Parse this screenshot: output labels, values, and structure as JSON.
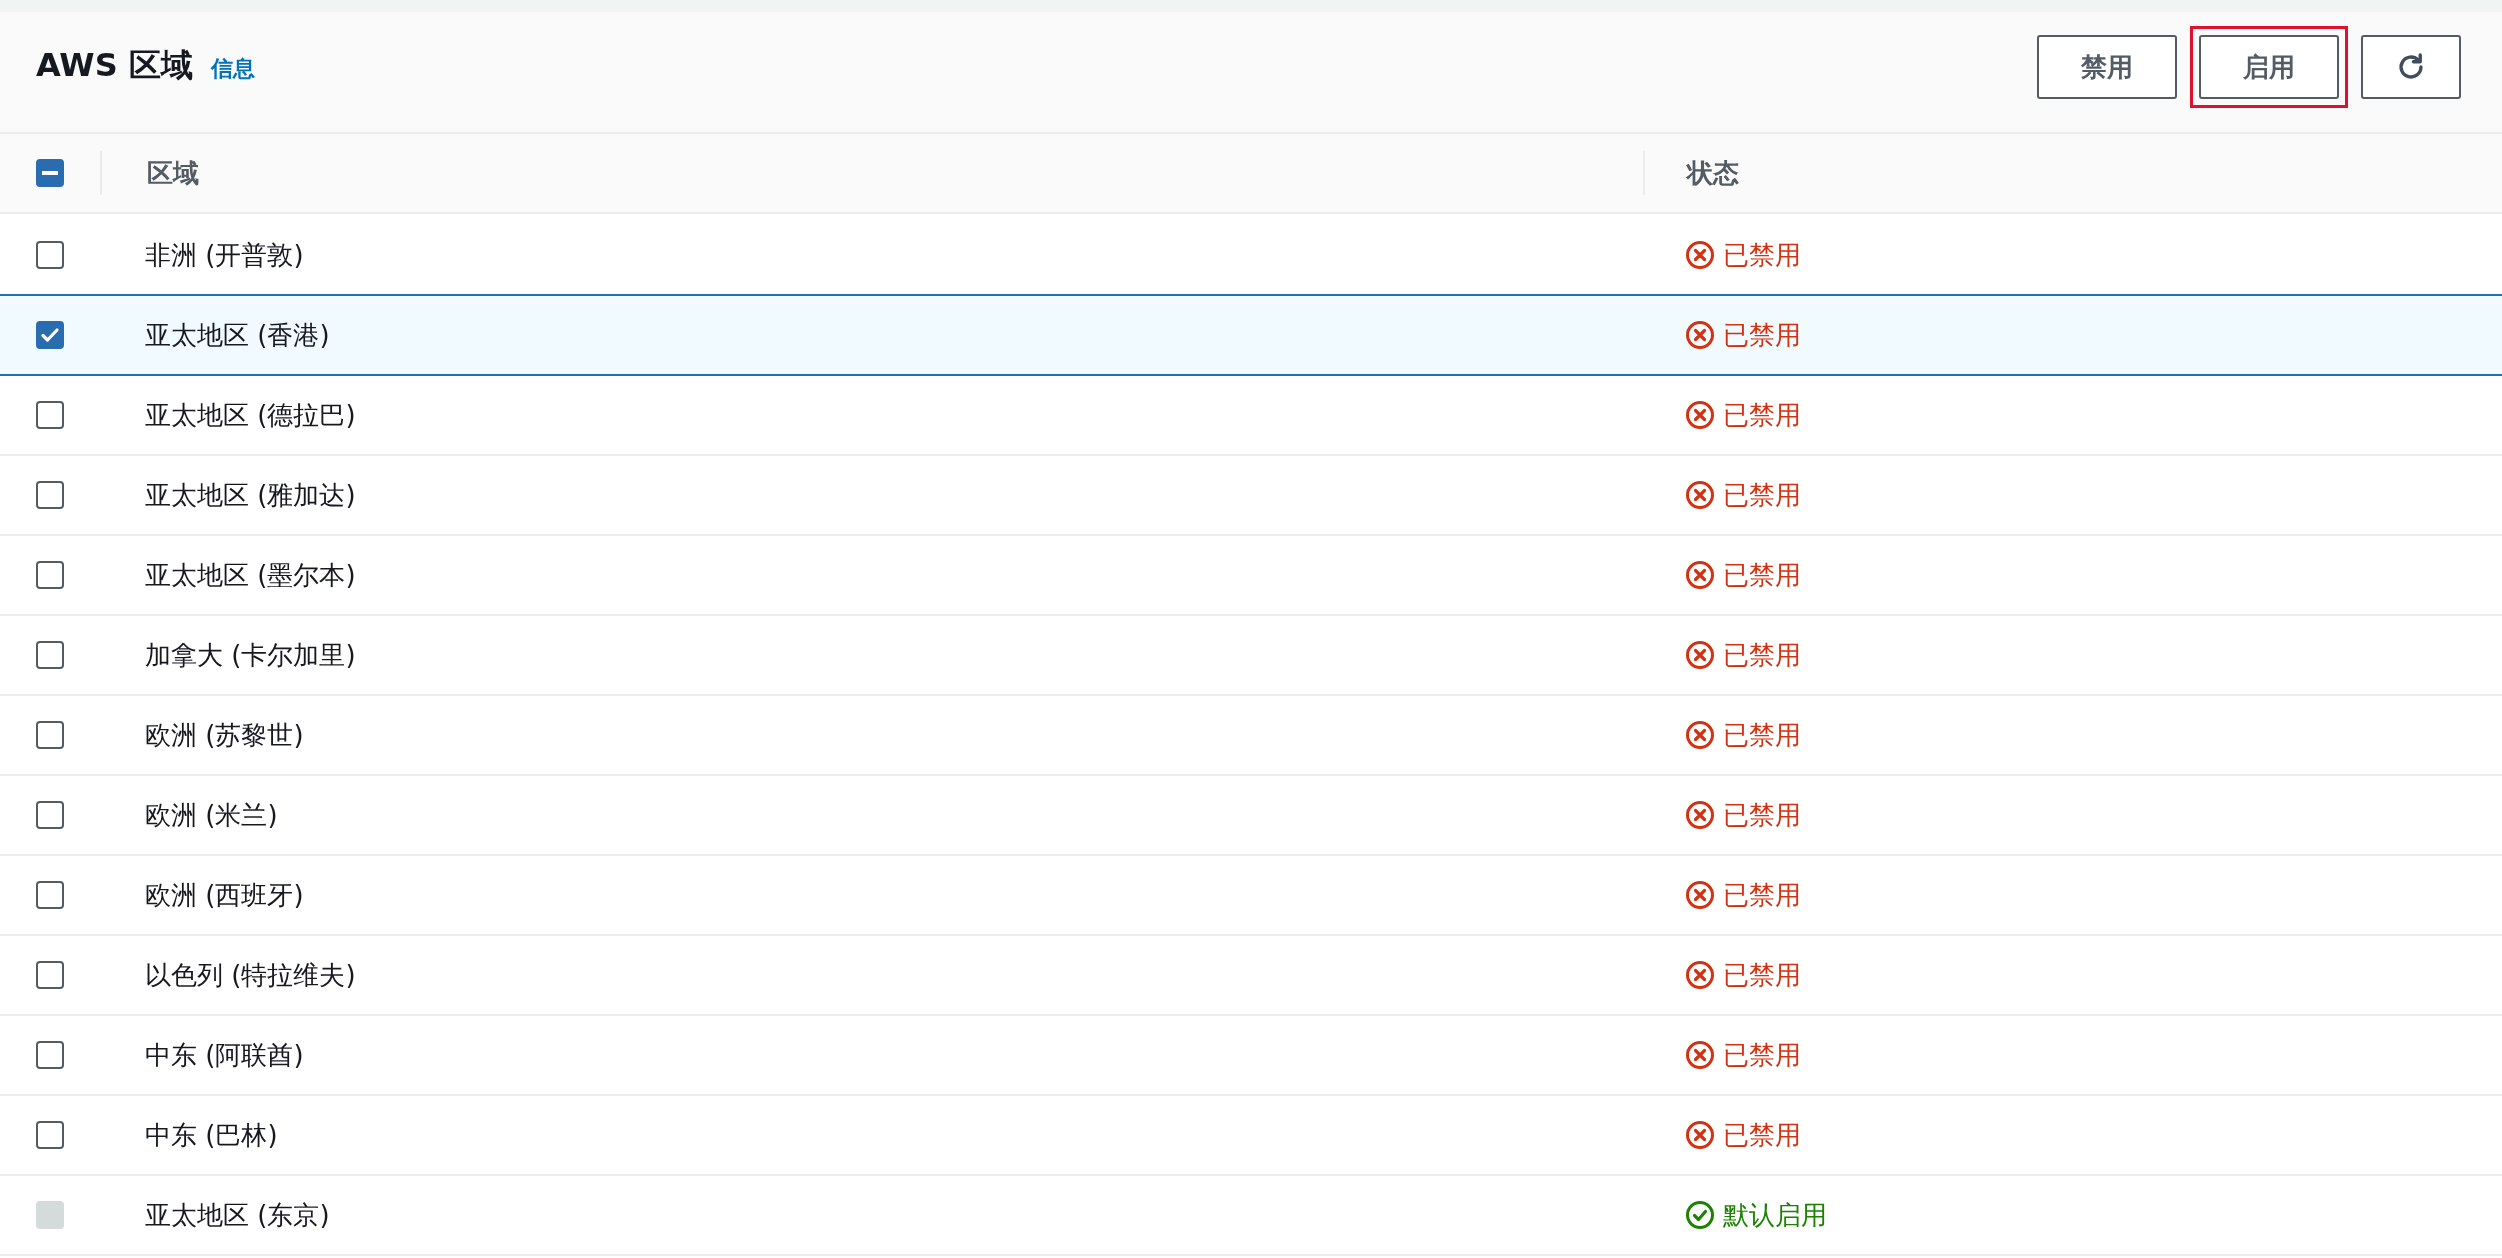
{
  "header": {
    "title": "AWS 区域",
    "info_link": "信息",
    "buttons": [
      {
        "kind": "text",
        "label": "禁用",
        "highlighted": false
      },
      {
        "kind": "text",
        "label": "启用",
        "highlighted": true
      },
      {
        "kind": "refresh",
        "highlighted": false
      }
    ]
  },
  "table": {
    "select_all": {
      "indeterminate": true
    },
    "columns": [
      "区域",
      "状态"
    ],
    "rows": [
      {
        "region": "非洲 (开普敦)",
        "status": "已禁用",
        "kind": "disabled",
        "selected": false,
        "locked": false
      },
      {
        "region": "亚太地区 (香港)",
        "status": "已禁用",
        "kind": "disabled",
        "selected": true,
        "locked": false
      },
      {
        "region": "亚太地区 (德拉巴)",
        "status": "已禁用",
        "kind": "disabled",
        "selected": false,
        "locked": false
      },
      {
        "region": "亚太地区 (雅加达)",
        "status": "已禁用",
        "kind": "disabled",
        "selected": false,
        "locked": false
      },
      {
        "region": "亚太地区 (墨尔本)",
        "status": "已禁用",
        "kind": "disabled",
        "selected": false,
        "locked": false
      },
      {
        "region": "加拿大 (卡尔加里)",
        "status": "已禁用",
        "kind": "disabled",
        "selected": false,
        "locked": false
      },
      {
        "region": "欧洲 (苏黎世)",
        "status": "已禁用",
        "kind": "disabled",
        "selected": false,
        "locked": false
      },
      {
        "region": "欧洲 (米兰)",
        "status": "已禁用",
        "kind": "disabled",
        "selected": false,
        "locked": false
      },
      {
        "region": "欧洲 (西班牙)",
        "status": "已禁用",
        "kind": "disabled",
        "selected": false,
        "locked": false
      },
      {
        "region": "以色列 (特拉维夫)",
        "status": "已禁用",
        "kind": "disabled",
        "selected": false,
        "locked": false
      },
      {
        "region": "中东 (阿联酋)",
        "status": "已禁用",
        "kind": "disabled",
        "selected": false,
        "locked": false
      },
      {
        "region": "中东 (巴林)",
        "status": "已禁用",
        "kind": "disabled",
        "selected": false,
        "locked": false
      },
      {
        "region": "亚太地区 (东京)",
        "status": "默认启用",
        "kind": "enabled",
        "selected": false,
        "locked": true
      }
    ]
  }
}
